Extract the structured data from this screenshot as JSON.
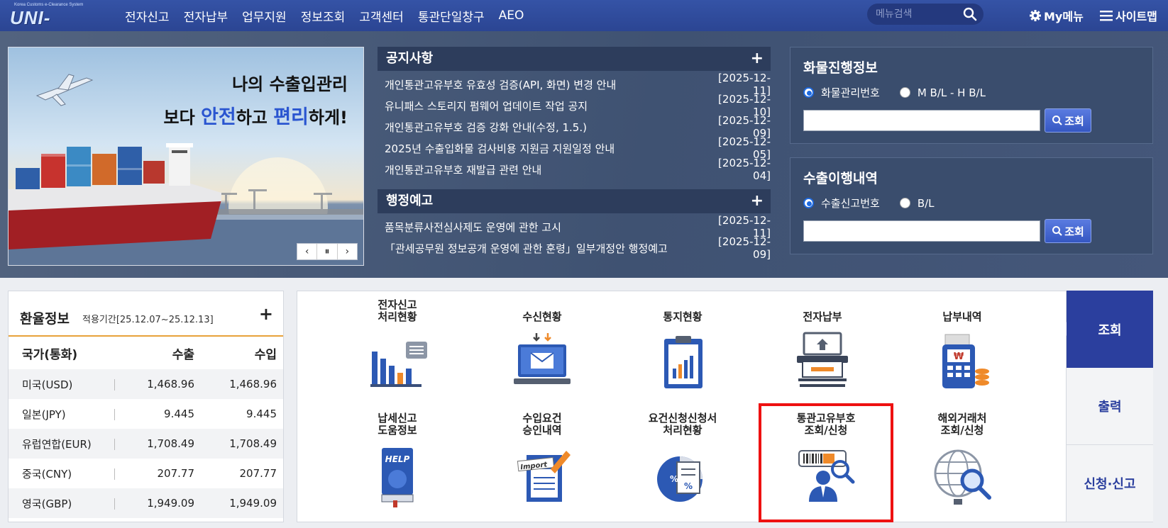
{
  "header": {
    "logo_small": "Korea Customs e-Clearance System",
    "logo_main": "UNI-PASS",
    "nav": [
      "전자신고",
      "전자납부",
      "업무지원",
      "정보조회",
      "고객센터",
      "통관단일창구",
      "AEO"
    ],
    "search_placeholder": "메뉴검색",
    "my_menu": "My메뉴",
    "sitemap": "사이트맵"
  },
  "banner": {
    "line1": "나의 수출입관리",
    "line2_pre": "보다 ",
    "line2_hl1": "안전",
    "line2_mid": "하고 ",
    "line2_hl2": "편리",
    "line2_post": "하게!",
    "controls": [
      "‹",
      "⏸",
      "›"
    ]
  },
  "notices": {
    "title": "공지사항",
    "plus": "+",
    "items": [
      {
        "title": "개인통관고유부호 유효성 검증(API, 화면) 변경 안내",
        "date": "[2025-12-11]"
      },
      {
        "title": "유니패스 스토리지 펌웨어 업데이트 작업 공지",
        "date": "[2025-12-10]"
      },
      {
        "title": "개인통관고유부호 검증 강화 안내(수정, 1.5.)",
        "date": "[2025-12-09]"
      },
      {
        "title": "2025년 수출입화물 검사비용 지원금 지원일정 안내",
        "date": "[2025-12-05]"
      },
      {
        "title": "개인통관고유부호 재발급 관련 안내",
        "date": "[2025-12-04]"
      }
    ]
  },
  "admin_notices": {
    "title": "행정예고",
    "plus": "+",
    "items": [
      {
        "title": "품목분류사전심사제도 운영에 관한 고시",
        "date": "[2025-12-11]"
      },
      {
        "title": "「관세공무원 정보공개 운영에 관한 훈령」일부개정안 행정예고",
        "date": "[2025-12-09]"
      }
    ]
  },
  "cargo": {
    "title": "화물진행정보",
    "options": [
      "화물관리번호",
      "M B/L - H B/L"
    ],
    "selected": 0,
    "button": "조회"
  },
  "export_history": {
    "title": "수출이행내역",
    "options": [
      "수출신고번호",
      "B/L"
    ],
    "selected": 0,
    "button": "조회"
  },
  "exchange": {
    "title": "환율정보",
    "period": "적용기간[25.12.07~25.12.13]",
    "plus": "+",
    "headers": [
      "국가(통화)",
      "수출",
      "수입"
    ],
    "rows": [
      {
        "country": "미국(USD)",
        "export": "1,468.96",
        "import": "1,468.96"
      },
      {
        "country": "일본(JPY)",
        "export": "9.445",
        "import": "9.445"
      },
      {
        "country": "유럽연합(EUR)",
        "export": "1,708.49",
        "import": "1,708.49"
      },
      {
        "country": "중국(CNY)",
        "export": "207.77",
        "import": "207.77"
      },
      {
        "country": "영국(GBP)",
        "export": "1,949.09",
        "import": "1,949.09"
      }
    ]
  },
  "services": [
    {
      "label": "전자신고\n처리현황",
      "icon": "bar-chart-icon"
    },
    {
      "label": "수신현황",
      "icon": "mail-monitor-icon"
    },
    {
      "label": "통지현황",
      "icon": "clipboard-chart-icon"
    },
    {
      "label": "전자납부",
      "icon": "card-payment-icon"
    },
    {
      "label": "납부내역",
      "icon": "payment-terminal-icon"
    },
    {
      "label": "납세신고\n도움정보",
      "icon": "help-book-icon"
    },
    {
      "label": "수입요건\n승인내역",
      "icon": "import-document-icon"
    },
    {
      "label": "요건신청신청서\n처리현황",
      "icon": "percent-document-icon"
    },
    {
      "label": "통관고유부호\n조회/신청",
      "icon": "barcode-person-icon"
    },
    {
      "label": "해외거래처\n조회/신청",
      "icon": "globe-search-icon"
    }
  ],
  "side_tabs": [
    "조회",
    "출력",
    "신청·신고"
  ],
  "colors": {
    "accent": "#2b3f9e",
    "highlight": "#e11111",
    "header": "#3553a6"
  }
}
